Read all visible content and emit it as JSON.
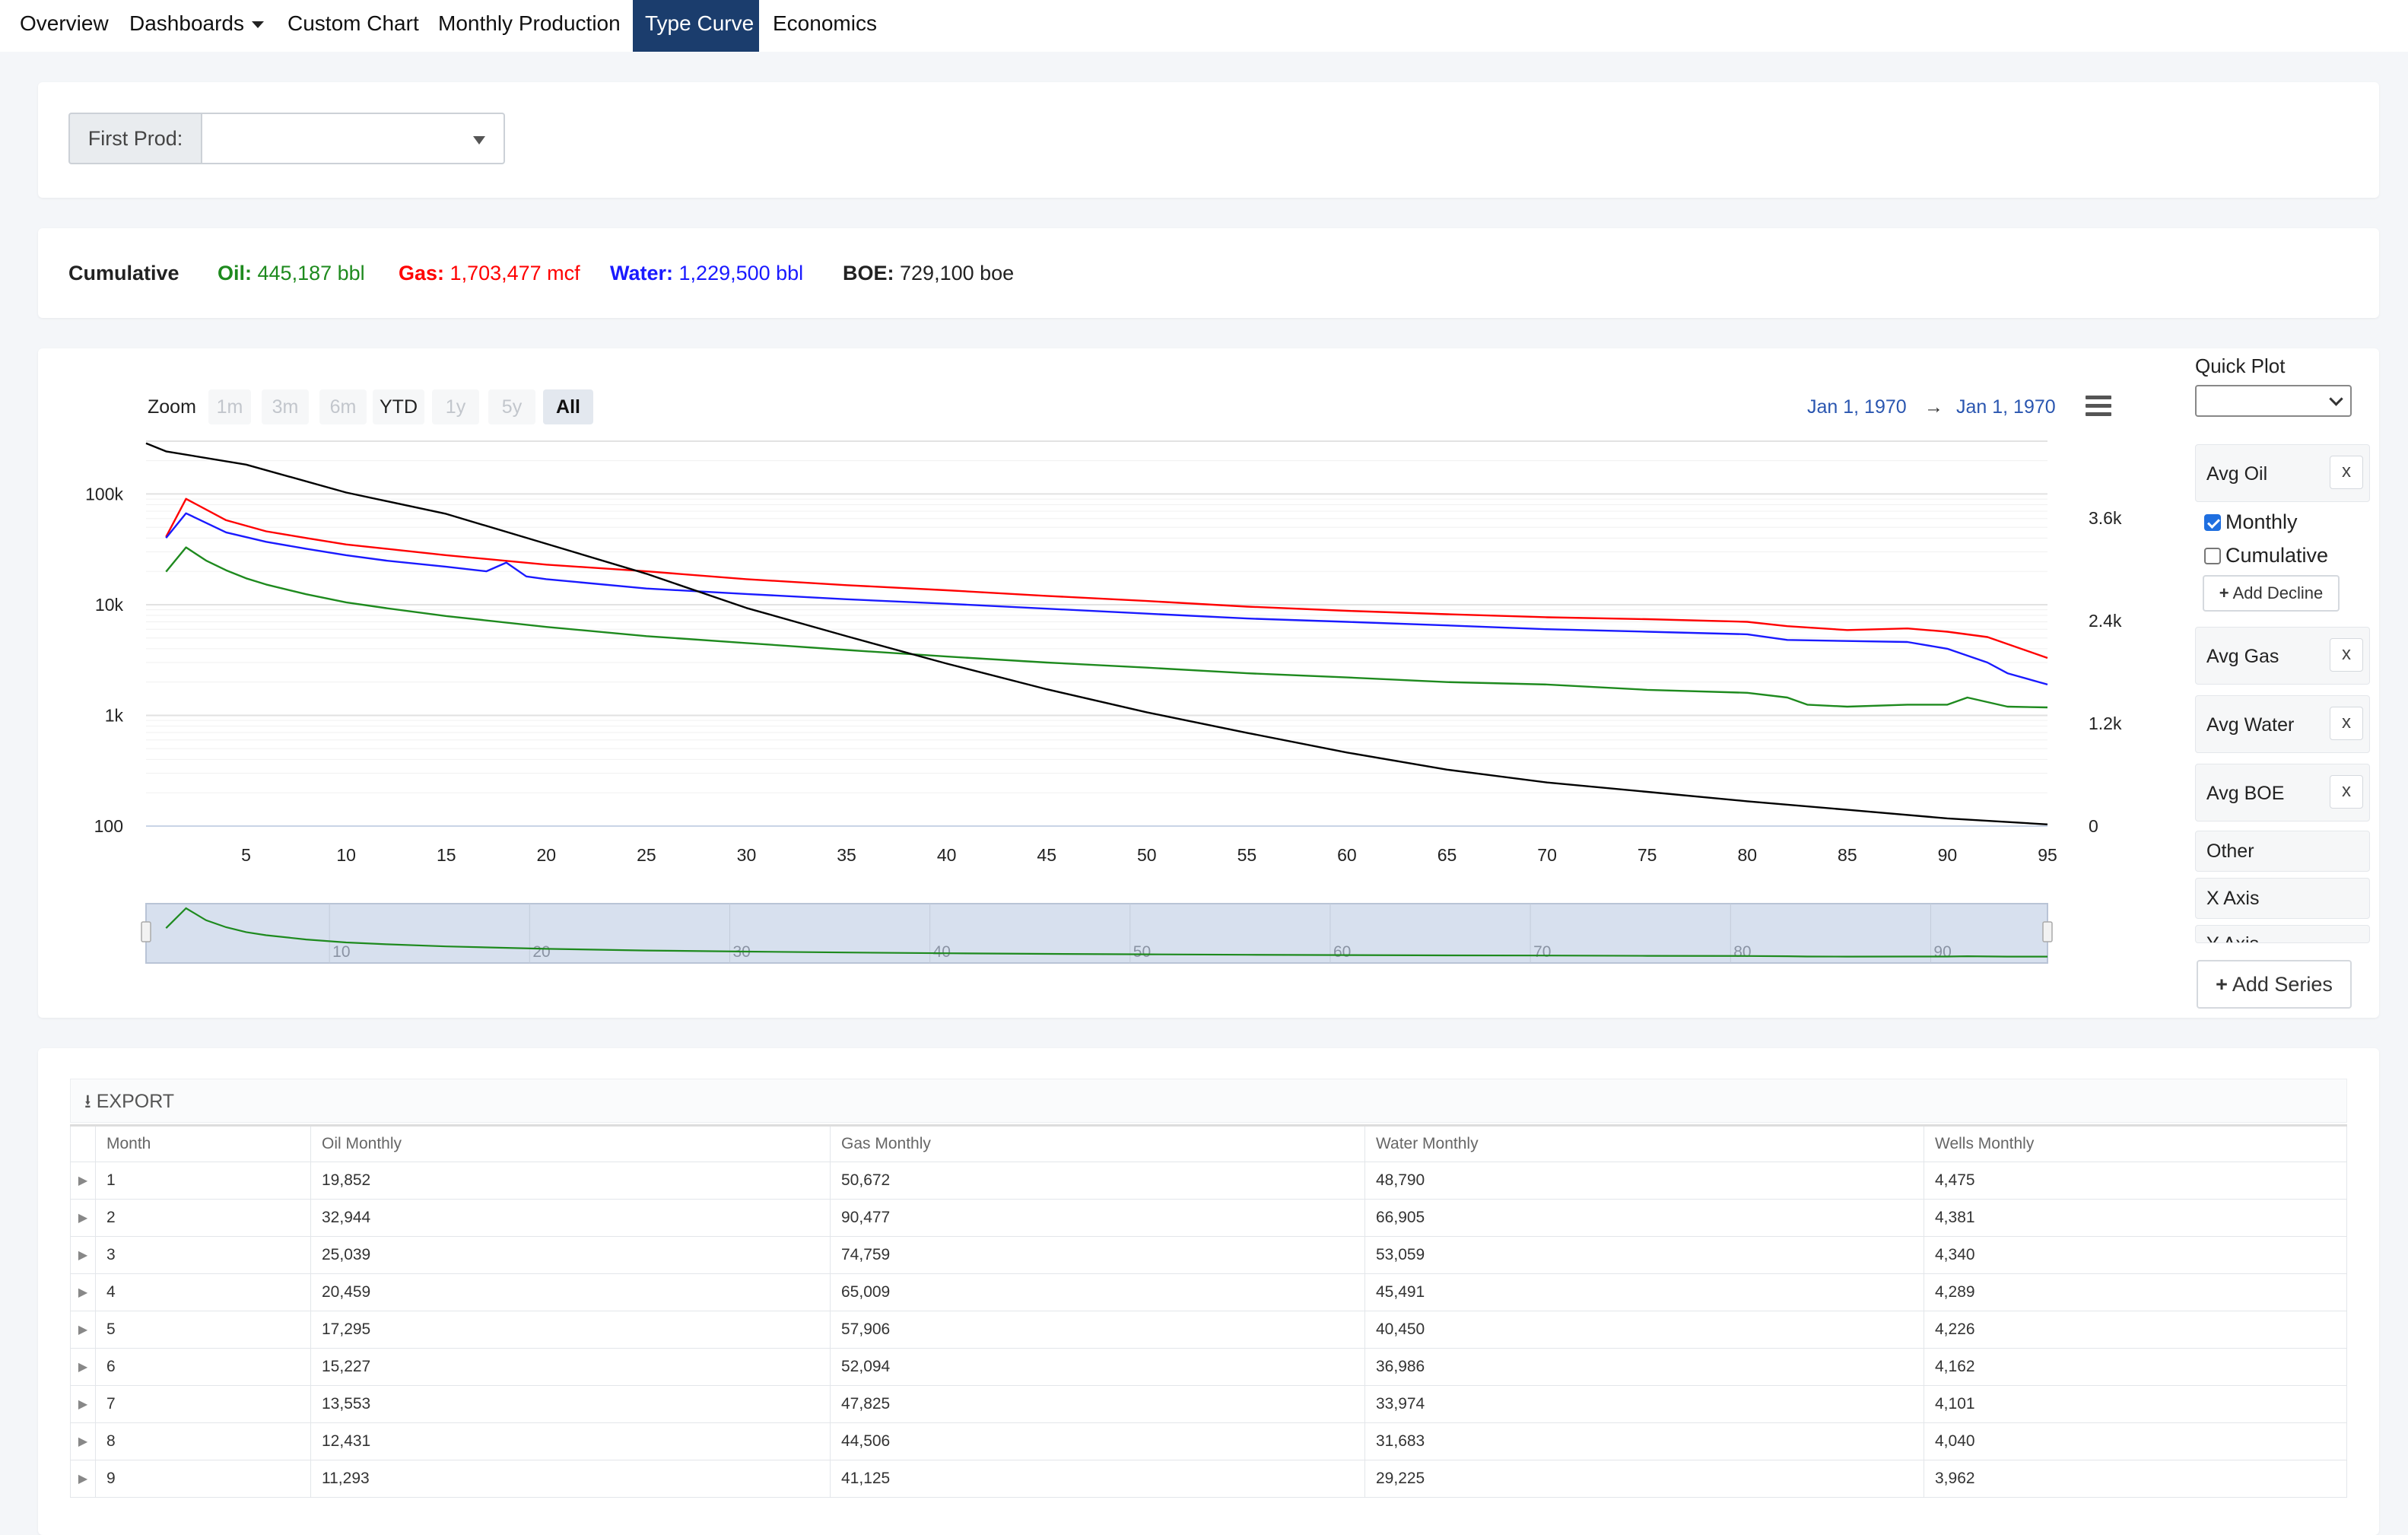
{
  "nav": {
    "tabs": [
      "Overview",
      "Dashboards",
      "Custom Chart",
      "Monthly Production",
      "Type Curve",
      "Economics"
    ],
    "active_tab": "Type Curve"
  },
  "filter": {
    "first_prod_label": "First Prod:",
    "first_prod_value": ""
  },
  "cumulative": {
    "heading": "Cumulative",
    "oil_label": "Oil:",
    "oil_value": "445,187 bbl",
    "gas_label": "Gas:",
    "gas_value": "1,703,477 mcf",
    "water_label": "Water:",
    "water_value": "1,229,500 bbl",
    "boe_label": "BOE:",
    "boe_value": "729,100 boe"
  },
  "colors": {
    "oil": "#1e8a1e",
    "gas": "#ff0000",
    "water": "#1a1aff",
    "boe": "#000000",
    "accent": "#1b3d6d"
  },
  "chart_controls": {
    "zoom_label": "Zoom",
    "zoom_buttons": [
      "1m",
      "3m",
      "6m",
      "YTD",
      "1y",
      "5y",
      "All"
    ],
    "zoom_selected": "All",
    "range_from": "Jan 1, 1970",
    "range_arrow": "→",
    "range_to": "Jan 1, 1970",
    "menu_icon": "hamburger-icon"
  },
  "chart_data": {
    "type": "line",
    "x_ticks": [
      5,
      10,
      15,
      20,
      25,
      30,
      35,
      40,
      45,
      50,
      55,
      60,
      65,
      70,
      75,
      80,
      85,
      90,
      95
    ],
    "y_left": {
      "scale": "log",
      "ticks": [
        "100",
        "1k",
        "10k",
        "100k"
      ],
      "range": [
        100,
        300000
      ]
    },
    "y_right": {
      "scale": "linear",
      "ticks": [
        "0",
        "1.2k",
        "2.4k",
        "3.6k"
      ],
      "range": [
        0,
        4500
      ]
    },
    "series": [
      {
        "key": "gas",
        "axis": "left",
        "x": [
          1,
          2,
          4,
          6,
          8,
          10,
          12,
          15,
          20,
          25,
          30,
          35,
          40,
          45,
          50,
          55,
          60,
          65,
          70,
          75,
          80,
          82,
          85,
          88,
          90,
          92,
          95
        ],
        "y": [
          41000,
          90477,
          58000,
          46000,
          40000,
          35000,
          32000,
          28000,
          23000,
          20000,
          17000,
          15000,
          13500,
          12000,
          10800,
          9600,
          8800,
          8200,
          7700,
          7400,
          7000,
          6400,
          5900,
          6100,
          5700,
          5100,
          3300
        ]
      },
      {
        "key": "water",
        "axis": "left",
        "x": [
          1,
          2,
          4,
          6,
          8,
          10,
          12,
          15,
          17,
          18,
          19,
          20,
          25,
          30,
          35,
          40,
          45,
          50,
          55,
          60,
          65,
          70,
          75,
          80,
          82,
          85,
          88,
          90,
          92,
          93,
          95
        ],
        "y": [
          40000,
          66905,
          45000,
          37000,
          32000,
          28000,
          25000,
          22000,
          20000,
          24000,
          18000,
          17000,
          14000,
          12500,
          11200,
          10200,
          9200,
          8300,
          7500,
          7000,
          6500,
          6000,
          5700,
          5400,
          4800,
          4700,
          4600,
          4000,
          3000,
          2400,
          1900
        ]
      },
      {
        "key": "oil",
        "axis": "left",
        "x": [
          1,
          2,
          3,
          4,
          5,
          6,
          8,
          10,
          12,
          15,
          20,
          25,
          30,
          35,
          40,
          45,
          50,
          55,
          60,
          65,
          70,
          75,
          80,
          82,
          83,
          85,
          88,
          90,
          91,
          93,
          95
        ],
        "y": [
          19852,
          32944,
          25039,
          20459,
          17295,
          15227,
          12431,
          10500,
          9300,
          7900,
          6300,
          5200,
          4500,
          3900,
          3400,
          3000,
          2700,
          2400,
          2200,
          2000,
          1900,
          1700,
          1600,
          1450,
          1250,
          1200,
          1250,
          1250,
          1450,
          1200,
          1180
        ]
      },
      {
        "key": "boe",
        "axis": "right",
        "x": [
          0,
          1,
          5,
          10,
          15,
          20,
          25,
          30,
          35,
          40,
          45,
          50,
          55,
          60,
          65,
          70,
          75,
          80,
          85,
          90,
          95
        ],
        "y": [
          4475,
          4381,
          4226,
          3900,
          3650,
          3300,
          2950,
          2550,
          2220,
          1900,
          1600,
          1330,
          1090,
          860,
          660,
          510,
          400,
          290,
          190,
          90,
          20
        ]
      }
    ],
    "navigator_ticks": [
      10,
      20,
      30,
      40,
      50,
      60,
      70,
      80,
      90
    ]
  },
  "sidebar": {
    "quick_plot_label": "Quick Plot",
    "quick_plot_value": "",
    "series_boxes": [
      {
        "label": "Avg Oil",
        "close": "x"
      },
      {
        "label": "Avg Gas",
        "close": "x"
      },
      {
        "label": "Avg Water",
        "close": "x"
      },
      {
        "label": "Avg BOE",
        "close": "x"
      }
    ],
    "monthly_label": "Monthly",
    "monthly_checked": true,
    "cumulative_label": "Cumulative",
    "cumulative_checked": false,
    "add_decline_label": "Add Decline",
    "other_label": "Other",
    "x_axis_label": "X Axis",
    "y_axis_label": "Y Axis",
    "add_series_label": "Add Series"
  },
  "table": {
    "export_label": "EXPORT",
    "columns": [
      "Month",
      "Oil Monthly",
      "Gas Monthly",
      "Water Monthly",
      "Wells Monthly"
    ],
    "rows": [
      [
        "1",
        "19,852",
        "50,672",
        "48,790",
        "4,475"
      ],
      [
        "2",
        "32,944",
        "90,477",
        "66,905",
        "4,381"
      ],
      [
        "3",
        "25,039",
        "74,759",
        "53,059",
        "4,340"
      ],
      [
        "4",
        "20,459",
        "65,009",
        "45,491",
        "4,289"
      ],
      [
        "5",
        "17,295",
        "57,906",
        "40,450",
        "4,226"
      ],
      [
        "6",
        "15,227",
        "52,094",
        "36,986",
        "4,162"
      ],
      [
        "7",
        "13,553",
        "47,825",
        "33,974",
        "4,101"
      ],
      [
        "8",
        "12,431",
        "44,506",
        "31,683",
        "4,040"
      ],
      [
        "9",
        "11,293",
        "41,125",
        "29,225",
        "3,962"
      ]
    ]
  }
}
